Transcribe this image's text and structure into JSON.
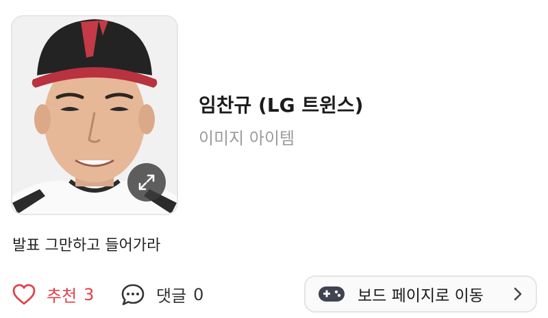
{
  "item": {
    "title": "임찬규 (LG 트윈스)",
    "subtitle": "이미지 아이템"
  },
  "post": {
    "text": "발표 그만하고 들어가라"
  },
  "actions": {
    "like_label": "추천",
    "like_count": "3",
    "comment_label": "댓글",
    "comment_count": "0",
    "board_button_label": "보드 페이지로 이동"
  },
  "icons": {
    "expand": "expand-icon",
    "heart": "heart-icon",
    "comment": "comment-bubble-icon",
    "gamepad": "gamepad-icon",
    "chevron": "chevron-right-icon"
  },
  "colors": {
    "like": "#e0414a",
    "muted": "#9a9a9a",
    "text": "#1b1b1b"
  }
}
